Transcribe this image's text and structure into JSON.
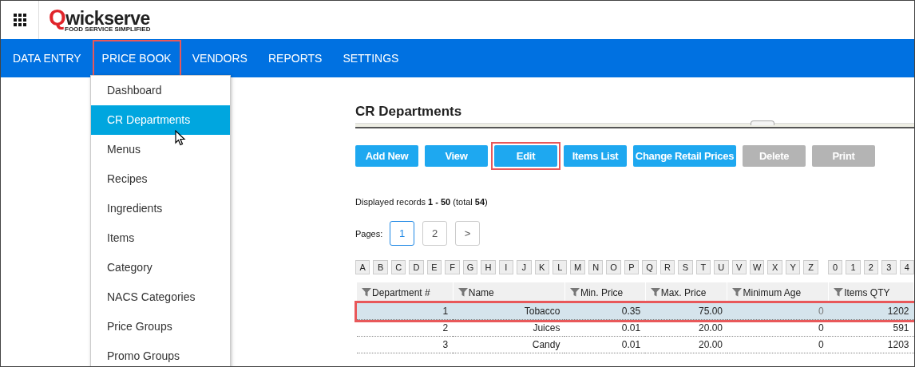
{
  "logo": {
    "name": "Qwickserve",
    "tagline": "FOOD SERVICE SIMPLIFIED"
  },
  "nav": [
    {
      "label": "DATA ENTRY",
      "highlighted": false
    },
    {
      "label": "PRICE BOOK",
      "highlighted": true
    },
    {
      "label": "VENDORS",
      "highlighted": false
    },
    {
      "label": "REPORTS",
      "highlighted": false
    },
    {
      "label": "SETTINGS",
      "highlighted": false
    }
  ],
  "dropdown": [
    {
      "label": "Dashboard",
      "selected": false
    },
    {
      "label": "CR Departments",
      "selected": true
    },
    {
      "label": "Menus",
      "selected": false
    },
    {
      "label": "Recipes",
      "selected": false
    },
    {
      "label": "Ingredients",
      "selected": false
    },
    {
      "label": "Items",
      "selected": false
    },
    {
      "label": "Category",
      "selected": false
    },
    {
      "label": "NACS Categories",
      "selected": false
    },
    {
      "label": "Price Groups",
      "selected": false
    },
    {
      "label": "Promo Groups",
      "selected": false
    }
  ],
  "page_title": "CR Departments",
  "buttons": [
    {
      "label": "Add New",
      "disabled": false,
      "highlighted": false
    },
    {
      "label": "View",
      "disabled": false,
      "highlighted": false
    },
    {
      "label": "Edit",
      "disabled": false,
      "highlighted": true
    },
    {
      "label": "Items List",
      "disabled": false,
      "highlighted": false
    },
    {
      "label": "Change Retail Prices",
      "disabled": false,
      "highlighted": false
    },
    {
      "label": "Delete",
      "disabled": true,
      "highlighted": false
    },
    {
      "label": "Print",
      "disabled": true,
      "highlighted": false
    }
  ],
  "records_info": "Displayed records **1 - 50** (total **54**)",
  "pages_label": "Pages:",
  "pages": [
    {
      "label": "1",
      "selected": true
    },
    {
      "label": "2",
      "selected": false
    },
    {
      "label": ">",
      "selected": false
    }
  ],
  "letters": [
    "A",
    "B",
    "C",
    "D",
    "E",
    "F",
    "G",
    "H",
    "I",
    "J",
    "K",
    "L",
    "M",
    "N",
    "O",
    "P",
    "Q",
    "R",
    "S",
    "T",
    "U",
    "V",
    "W",
    "X",
    "Y",
    "Z",
    "0",
    "1",
    "2",
    "3",
    "4"
  ],
  "table": {
    "columns": [
      "Department #",
      "Name",
      "Min. Price",
      "Max. Price",
      "Minimum Age",
      "Items QTY"
    ],
    "rows": [
      {
        "cells": [
          "1",
          "Tobacco",
          "0.35",
          "75.00",
          "0",
          "1202"
        ],
        "selected": true,
        "highlighted": true
      },
      {
        "cells": [
          "2",
          "Juices",
          "0.01",
          "20.00",
          "0",
          "591"
        ],
        "selected": false,
        "highlighted": false
      },
      {
        "cells": [
          "3",
          "Candy",
          "0.01",
          "20.00",
          "0",
          "1203"
        ],
        "selected": false,
        "highlighted": false
      }
    ]
  }
}
